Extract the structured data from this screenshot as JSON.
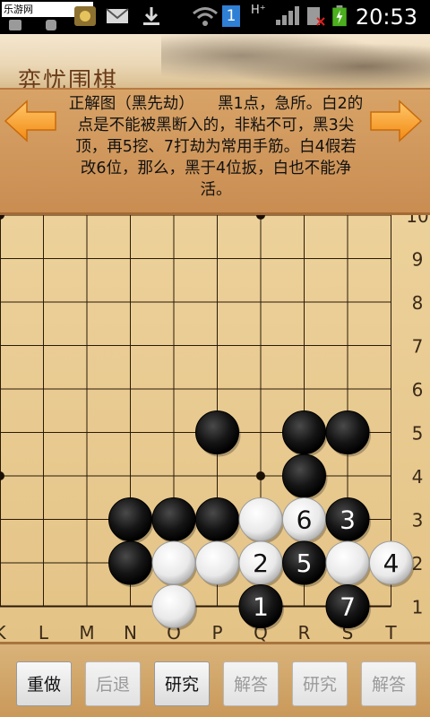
{
  "status_bar": {
    "site_label": "乐游网 www.962.net",
    "notification_badge": "1",
    "network": "H⁺",
    "time": "20:53",
    "icons": [
      "usb-icon",
      "android-icon",
      "email-icon",
      "download-icon",
      "wifi-icon",
      "notification-icon",
      "network-icon",
      "signal-icon",
      "sim-icon",
      "battery-icon"
    ]
  },
  "banner": {
    "logo_text": "弈忧围棋"
  },
  "problem": {
    "description": "正解图（黑先劫）　　黑1点，急所。白2的点是不能被黑断入的，非粘不可，黑3尖顶，再5挖、7打劫为常用手筋。白4假若改6位，那么，黑于4位扳，白也不能净活。",
    "prev_icon": "left-arrow-icon",
    "next_icon": "right-arrow-icon"
  },
  "board": {
    "columns": [
      "K",
      "L",
      "M",
      "N",
      "O",
      "P",
      "Q",
      "R",
      "S",
      "T"
    ],
    "rows": [
      "10",
      "9",
      "8",
      "7",
      "6",
      "5",
      "4",
      "3",
      "2",
      "1"
    ],
    "stones": [
      {
        "color": "black",
        "col": "P",
        "row": "5",
        "label": ""
      },
      {
        "color": "black",
        "col": "R",
        "row": "5",
        "label": ""
      },
      {
        "color": "black",
        "col": "S",
        "row": "5",
        "label": ""
      },
      {
        "color": "black",
        "col": "R",
        "row": "4",
        "label": ""
      },
      {
        "color": "black",
        "col": "N",
        "row": "3",
        "label": ""
      },
      {
        "color": "black",
        "col": "O",
        "row": "3",
        "label": ""
      },
      {
        "color": "black",
        "col": "P",
        "row": "3",
        "label": ""
      },
      {
        "color": "white",
        "col": "Q",
        "row": "3",
        "label": ""
      },
      {
        "color": "white",
        "col": "R",
        "row": "3",
        "label": "6"
      },
      {
        "color": "black",
        "col": "S",
        "row": "3",
        "label": "3"
      },
      {
        "color": "black",
        "col": "N",
        "row": "2",
        "label": ""
      },
      {
        "color": "white",
        "col": "O",
        "row": "2",
        "label": ""
      },
      {
        "color": "white",
        "col": "P",
        "row": "2",
        "label": ""
      },
      {
        "color": "white",
        "col": "Q",
        "row": "2",
        "label": "2"
      },
      {
        "color": "black",
        "col": "R",
        "row": "2",
        "label": "5"
      },
      {
        "color": "white",
        "col": "S",
        "row": "2",
        "label": ""
      },
      {
        "color": "white",
        "col": "T",
        "row": "2",
        "label": "4"
      },
      {
        "color": "white",
        "col": "O",
        "row": "1",
        "label": ""
      },
      {
        "color": "black",
        "col": "Q",
        "row": "1",
        "label": "1"
      },
      {
        "color": "black",
        "col": "S",
        "row": "1",
        "label": "7"
      }
    ],
    "star_points": [
      {
        "col": "K",
        "row": "10"
      },
      {
        "col": "Q",
        "row": "10"
      },
      {
        "col": "K",
        "row": "4"
      },
      {
        "col": "Q",
        "row": "4"
      }
    ]
  },
  "toolbar": {
    "redo": "重做",
    "back": "后退",
    "study": "研究",
    "answer": "解答",
    "btn5": "研究",
    "btn6": "解答"
  }
}
